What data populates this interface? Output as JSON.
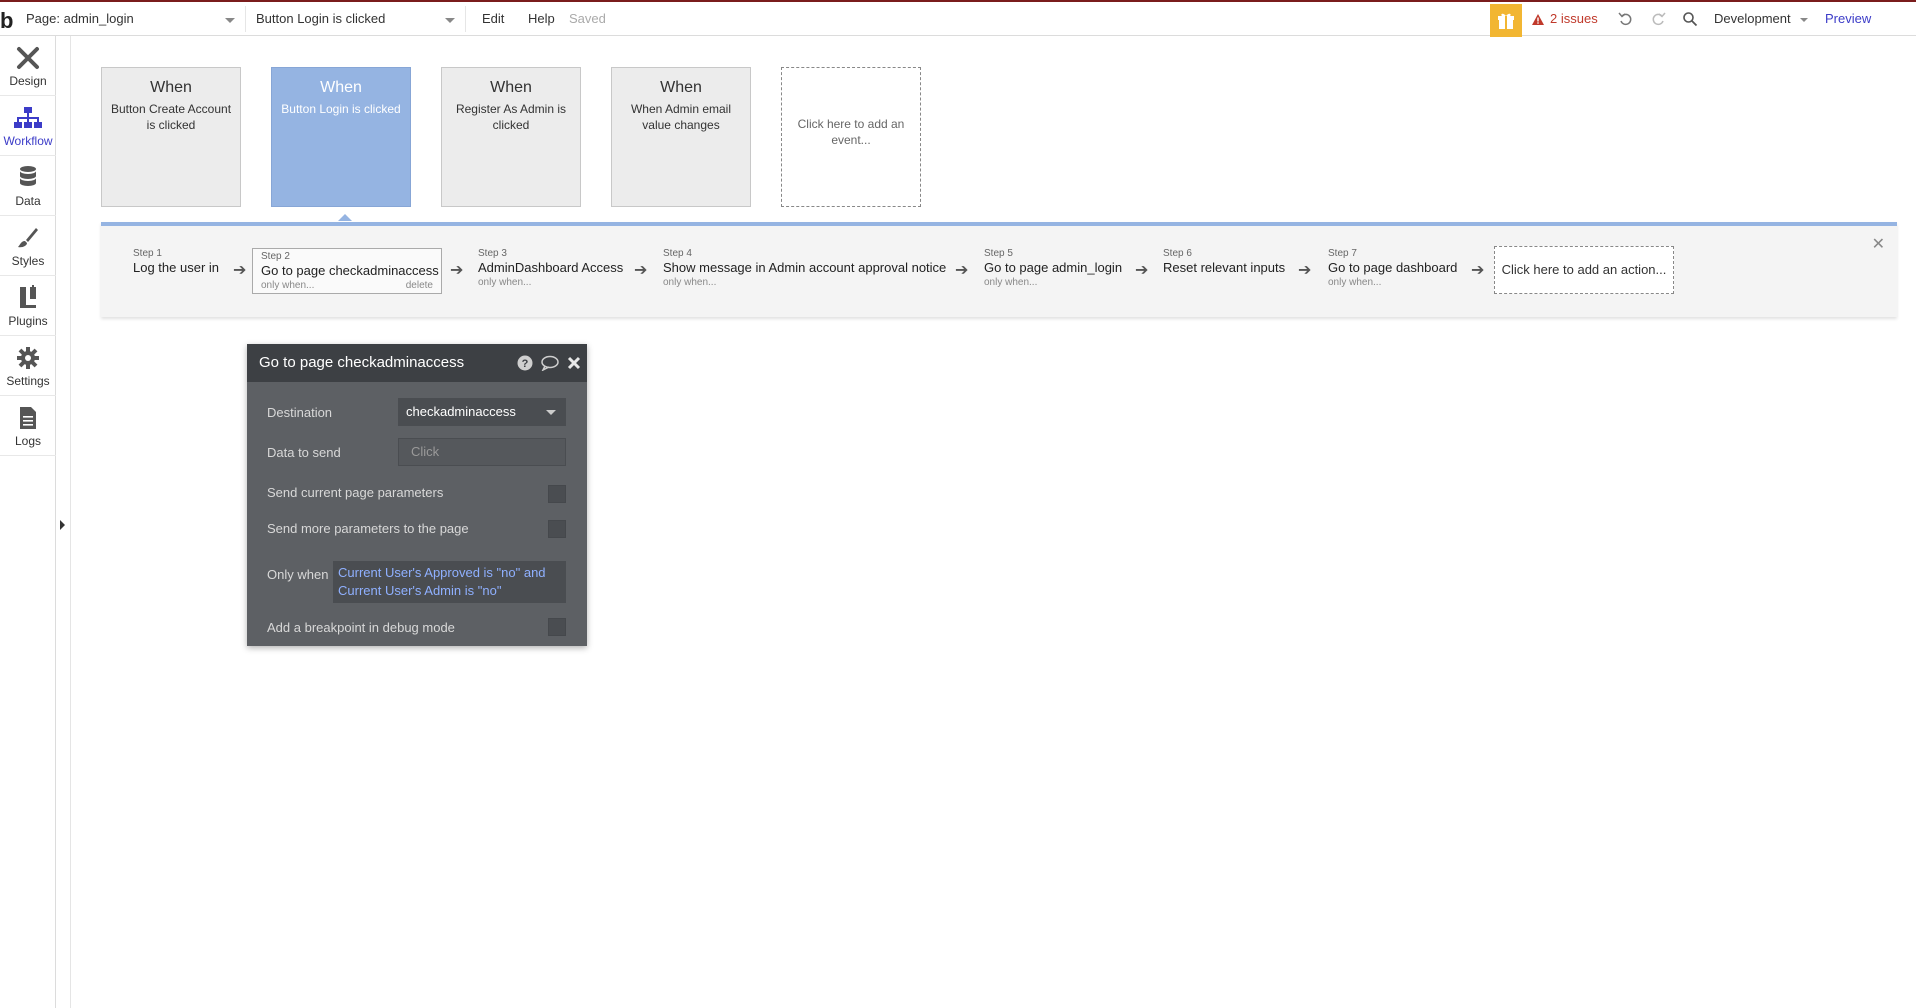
{
  "topbar": {
    "logo": "b",
    "page_select": "Page: admin_login",
    "event_select": "Button Login is clicked",
    "menu_edit": "Edit",
    "menu_help": "Help",
    "saved_status": "Saved",
    "issues_label": "2 issues",
    "environment": "Development",
    "preview": "Preview"
  },
  "sidebar": {
    "items": [
      {
        "label": "Design",
        "icon": "design-icon"
      },
      {
        "label": "Workflow",
        "icon": "workflow-icon"
      },
      {
        "label": "Data",
        "icon": "database-icon"
      },
      {
        "label": "Styles",
        "icon": "brush-icon"
      },
      {
        "label": "Plugins",
        "icon": "plug-icon"
      },
      {
        "label": "Settings",
        "icon": "gear-icon"
      },
      {
        "label": "Logs",
        "icon": "document-icon"
      }
    ]
  },
  "events": [
    {
      "when": "When",
      "desc": "Button Create Account is clicked"
    },
    {
      "when": "When",
      "desc": "Button Login is clicked"
    },
    {
      "when": "When",
      "desc": "Register As Admin is clicked"
    },
    {
      "when": "When",
      "desc": "When Admin email value changes"
    },
    {
      "desc": "Click here to add an event..."
    }
  ],
  "steps": [
    {
      "num": "Step 1",
      "title": "Log the user in",
      "cond": ""
    },
    {
      "num": "Step 2",
      "title": "Go to page checkadminaccess",
      "cond": "only when...",
      "delete": "delete"
    },
    {
      "num": "Step 3",
      "title": "AdminDashboard Access",
      "cond": "only when..."
    },
    {
      "num": "Step 4",
      "title": "Show message in Admin account approval notice",
      "cond": "only when..."
    },
    {
      "num": "Step 5",
      "title": "Go to page admin_login",
      "cond": "only when..."
    },
    {
      "num": "Step 6",
      "title": "Reset relevant inputs",
      "cond": ""
    },
    {
      "num": "Step 7",
      "title": "Go to page dashboard",
      "cond": "only when..."
    }
  ],
  "add_action": "Click here to add an action...",
  "panel": {
    "title": "Go to page checkadminaccess",
    "destination_label": "Destination",
    "destination_value": "checkadminaccess",
    "data_to_send_label": "Data to send",
    "data_to_send_placeholder": "Click",
    "send_current_params_label": "Send current page parameters",
    "send_more_params_label": "Send more parameters to the page",
    "only_when_label": "Only when",
    "only_when_value": "Current User's Approved is \"no\" and Current User's Admin is \"no\"",
    "breakpoint_label": "Add a breakpoint in debug mode"
  }
}
